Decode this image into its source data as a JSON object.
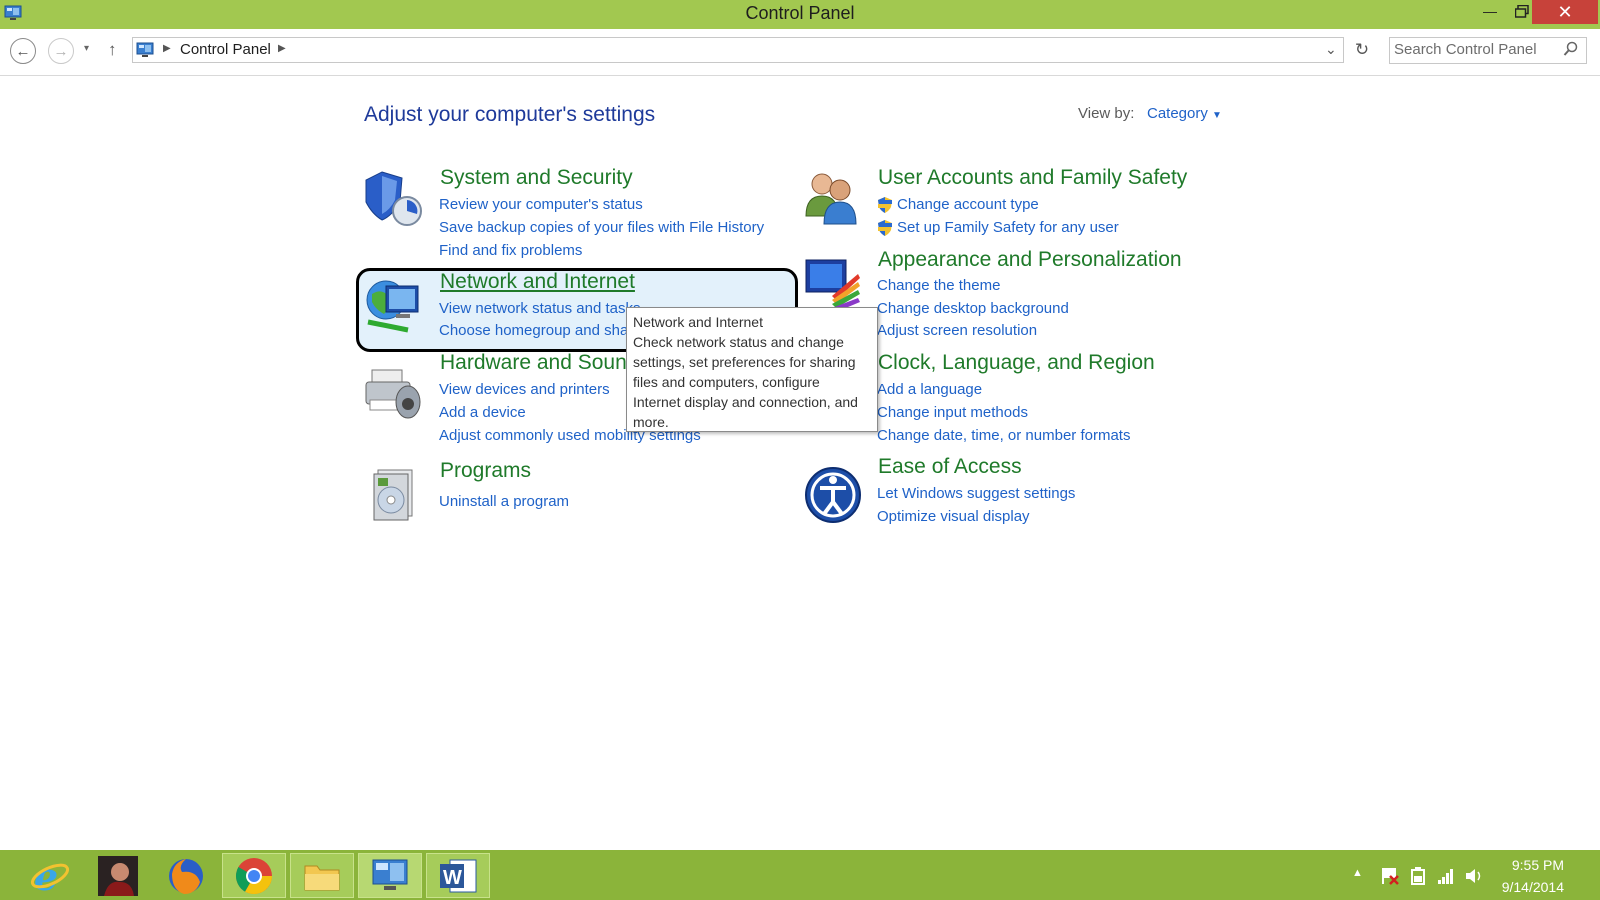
{
  "window": {
    "title": "Control Panel"
  },
  "address": {
    "breadcrumb": "Control Panel",
    "search_placeholder": "Search Control Panel"
  },
  "content": {
    "heading": "Adjust your computer's settings",
    "view_by_label": "View by:",
    "view_by_value": "Category"
  },
  "categories": [
    {
      "title": "System and Security",
      "links": [
        "Review your computer's status",
        "Save backup copies of your files with File History",
        "Find and fix problems"
      ]
    },
    {
      "title": "Network and Internet",
      "links": [
        "View network status and tasks",
        "Choose homegroup and sharing options"
      ]
    },
    {
      "title": "Hardware and Sound",
      "links": [
        "View devices and printers",
        "Add a device",
        "Adjust commonly used mobility settings"
      ]
    },
    {
      "title": "Programs",
      "links": [
        "Uninstall a program"
      ]
    },
    {
      "title": "User Accounts and Family Safety",
      "links": [
        "Change account type",
        "Set up Family Safety for any user"
      ]
    },
    {
      "title": "Appearance and Personalization",
      "links": [
        "Change the theme",
        "Change desktop background",
        "Adjust screen resolution"
      ]
    },
    {
      "title": "Clock, Language, and Region",
      "links": [
        "Add a language",
        "Change input methods",
        "Change date, time, or number formats"
      ]
    },
    {
      "title": "Ease of Access",
      "links": [
        "Let Windows suggest settings",
        "Optimize visual display"
      ]
    }
  ],
  "tooltip": {
    "title": "Network and Internet",
    "body": "Check network status and change settings, set preferences for sharing files and computers, configure Internet display and connection, and more."
  },
  "taskbar": {
    "apps": [
      "internet-explorer",
      "user-photo",
      "firefox",
      "chrome",
      "file-explorer",
      "control-panel",
      "word"
    ],
    "time": "9:55 PM",
    "date": "9/14/2014"
  },
  "colors": {
    "title_bar": "#a2c850",
    "taskbar": "#8bb43a",
    "link": "#1f62c8",
    "category": "#1f7a2a",
    "close": "#c7423a"
  }
}
